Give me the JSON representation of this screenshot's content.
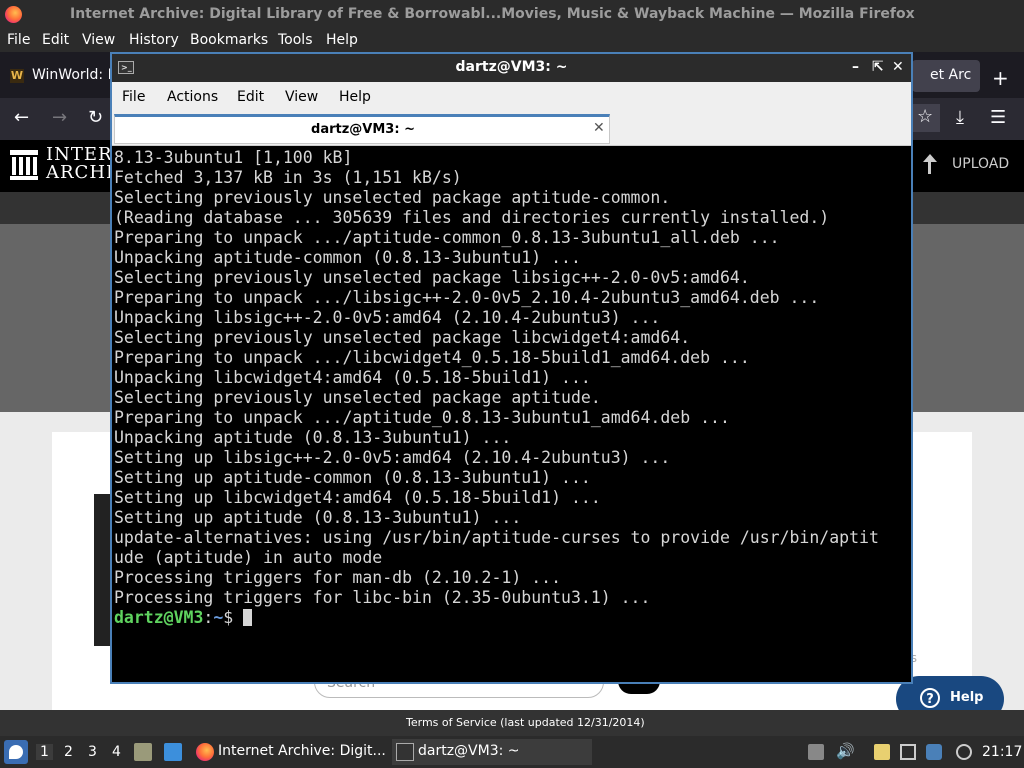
{
  "firefox": {
    "window_title": "Internet Archive: Digital Library of Free & Borrowabl...Movies, Music & Wayback Machine — Mozilla Firefox",
    "menu": [
      "File",
      "Edit",
      "View",
      "History",
      "Bookmarks",
      "Tools",
      "Help"
    ],
    "tabs": [
      {
        "label": "WinWorld: M",
        "icon": "winworld-icon"
      },
      {
        "label": "et Arc",
        "icon": "archive-icon"
      }
    ],
    "nav_icons": [
      "back-arrow-icon",
      "forward-arrow-icon",
      "reload-icon",
      "bookmark-star-icon",
      "download-icon",
      "hamburger-menu-icon"
    ]
  },
  "archive_page": {
    "brand_line1": "INTERN",
    "brand_line2": "ARCHIV",
    "upload_label": "UPLOAD",
    "search_placeholder": "Search",
    "faint_text": "ts",
    "help_label": "Help",
    "footer_text": "Terms of Service (last updated 12/31/2014)"
  },
  "terminal": {
    "window_title": "dartz@VM3: ~",
    "menu": [
      "File",
      "Actions",
      "Edit",
      "View",
      "Help"
    ],
    "tab_label": "dartz@VM3: ~",
    "output_lines": [
      "8.13-3ubuntu1 [1,100 kB]",
      "Fetched 3,137 kB in 3s (1,151 kB/s)",
      "Selecting previously unselected package aptitude-common.",
      "(Reading database ... 305639 files and directories currently installed.)",
      "Preparing to unpack .../aptitude-common_0.8.13-3ubuntu1_all.deb ...",
      "Unpacking aptitude-common (0.8.13-3ubuntu1) ...",
      "Selecting previously unselected package libsigc++-2.0-0v5:amd64.",
      "Preparing to unpack .../libsigc++-2.0-0v5_2.10.4-2ubuntu3_amd64.deb ...",
      "Unpacking libsigc++-2.0-0v5:amd64 (2.10.4-2ubuntu3) ...",
      "Selecting previously unselected package libcwidget4:amd64.",
      "Preparing to unpack .../libcwidget4_0.5.18-5build1_amd64.deb ...",
      "Unpacking libcwidget4:amd64 (0.5.18-5build1) ...",
      "Selecting previously unselected package aptitude.",
      "Preparing to unpack .../aptitude_0.8.13-3ubuntu1_amd64.deb ...",
      "Unpacking aptitude (0.8.13-3ubuntu1) ...",
      "Setting up libsigc++-2.0-0v5:amd64 (2.10.4-2ubuntu3) ...",
      "Setting up aptitude-common (0.8.13-3ubuntu1) ...",
      "Setting up libcwidget4:amd64 (0.5.18-5build1) ...",
      "Setting up aptitude (0.8.13-3ubuntu1) ...",
      "update-alternatives: using /usr/bin/aptitude-curses to provide /usr/bin/aptit",
      "ude (aptitude) in auto mode",
      "Processing triggers for man-db (2.10.2-1) ...",
      "Processing triggers for libc-bin (2.35-0ubuntu3.1) ..."
    ],
    "prompt_user": "dartz@VM3",
    "prompt_sep": ":",
    "prompt_path": "~",
    "prompt_symbol": "$ ",
    "colors": {
      "prompt_user": "#5fd35f",
      "prompt_path": "#6a9bdc",
      "text": "#d6d6d6",
      "background": "#000000",
      "accent": "#4a80b8"
    }
  },
  "panel": {
    "workspaces": [
      "1",
      "2",
      "3",
      "4"
    ],
    "active_workspace": "1",
    "tasks": [
      {
        "label": "Internet Archive: Digit...",
        "icon": "firefox-icon"
      },
      {
        "label": "dartz@VM3: ~",
        "icon": "terminal-icon"
      }
    ],
    "clock": "21:17"
  }
}
